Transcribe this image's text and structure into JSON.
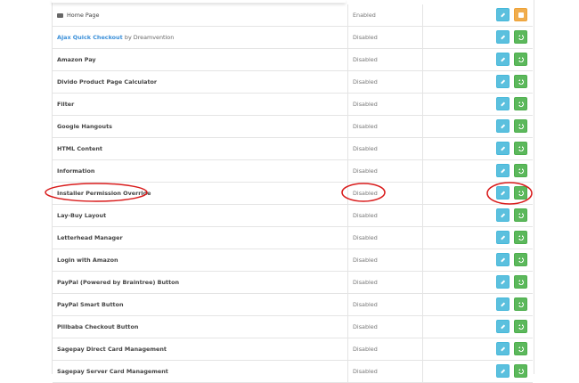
{
  "modules": [
    {
      "name": "Home Page",
      "by": "",
      "status": "Enabled",
      "installed": true,
      "home": true
    },
    {
      "name": "Ajax Quick Checkout",
      "by": "by Dreamvention",
      "status": "Disabled",
      "installed": false,
      "link": true
    },
    {
      "name": "Amazon Pay",
      "status": "Disabled",
      "installed": false
    },
    {
      "name": "Divido Product Page Calculator",
      "status": "Disabled",
      "installed": false
    },
    {
      "name": "Filter",
      "status": "Disabled",
      "installed": false
    },
    {
      "name": "Google Hangouts",
      "status": "Disabled",
      "installed": false
    },
    {
      "name": "HTML Content",
      "status": "Disabled",
      "installed": false
    },
    {
      "name": "Information",
      "status": "Disabled",
      "installed": false
    },
    {
      "name": "Installer Permission Override",
      "status": "Disabled",
      "installed": false
    },
    {
      "name": "Lay-Buy Layout",
      "status": "Disabled",
      "installed": false
    },
    {
      "name": "Letterhead Manager",
      "status": "Disabled",
      "installed": false
    },
    {
      "name": "Login with Amazon",
      "status": "Disabled",
      "installed": false
    },
    {
      "name": "PayPal (Powered by Braintree) Button",
      "status": "Disabled",
      "installed": false
    },
    {
      "name": "PayPal Smart Button",
      "status": "Disabled",
      "installed": false
    },
    {
      "name": "Pillbaba Checkout Button",
      "status": "Disabled",
      "installed": false
    },
    {
      "name": "Sagepay Direct Card Management",
      "status": "Disabled",
      "installed": false
    },
    {
      "name": "Sagepay Server Card Management",
      "status": "Disabled",
      "installed": false
    }
  ],
  "colors": {
    "edit": "#5bc0de",
    "install": "#5cb85c",
    "setting": "#f0ad4e",
    "link": "#3a8fd9",
    "annotation": "#d91c1c"
  },
  "icons": {
    "home": "home-icon",
    "edit": "pencil-icon",
    "install": "plus-circle-icon",
    "setting": "gear-icon"
  }
}
